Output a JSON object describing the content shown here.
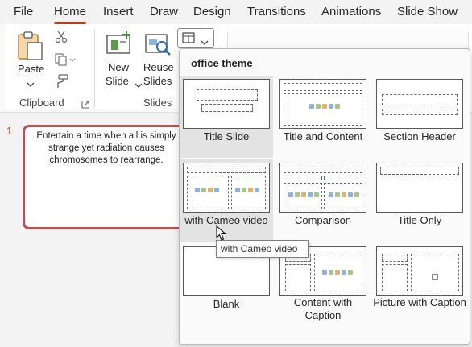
{
  "menu": {
    "tabs": [
      {
        "label": "File"
      },
      {
        "label": "Home"
      },
      {
        "label": "Insert"
      },
      {
        "label": "Draw"
      },
      {
        "label": "Design"
      },
      {
        "label": "Transitions"
      },
      {
        "label": "Animations"
      },
      {
        "label": "Slide Show"
      }
    ],
    "active_tab": "Home",
    "accent_color": "#c43e1c"
  },
  "ribbon": {
    "clipboard": {
      "paste_label": "Paste",
      "group_label": "Clipboard",
      "icons": [
        "paste-icon",
        "cut-icon",
        "copy-icon",
        "format-painter-icon",
        "dialog-launcher-icon"
      ]
    },
    "slides": {
      "new_slide_line1": "New",
      "new_slide_line2": "Slide",
      "reuse_line1": "Reuse",
      "reuse_line2": "Slides",
      "group_label": "Slides"
    }
  },
  "slide_panel": {
    "number": "1",
    "text": "Entertain a time when all is simply strange yet radiation causes chromosomes to rearrange."
  },
  "layout_gallery": {
    "title": "office theme",
    "layouts": [
      {
        "label": "Title Slide"
      },
      {
        "label": "Title and Content"
      },
      {
        "label": "Section Header"
      },
      {
        "label": "with Cameo video"
      },
      {
        "label": "Comparison"
      },
      {
        "label": "Title Only"
      },
      {
        "label": "Blank"
      },
      {
        "label": "Content with Caption"
      },
      {
        "label": "Picture with Caption"
      }
    ],
    "highlighted": [
      "Title Slide",
      "with Cameo video"
    ],
    "tooltip": "with Cameo video"
  }
}
